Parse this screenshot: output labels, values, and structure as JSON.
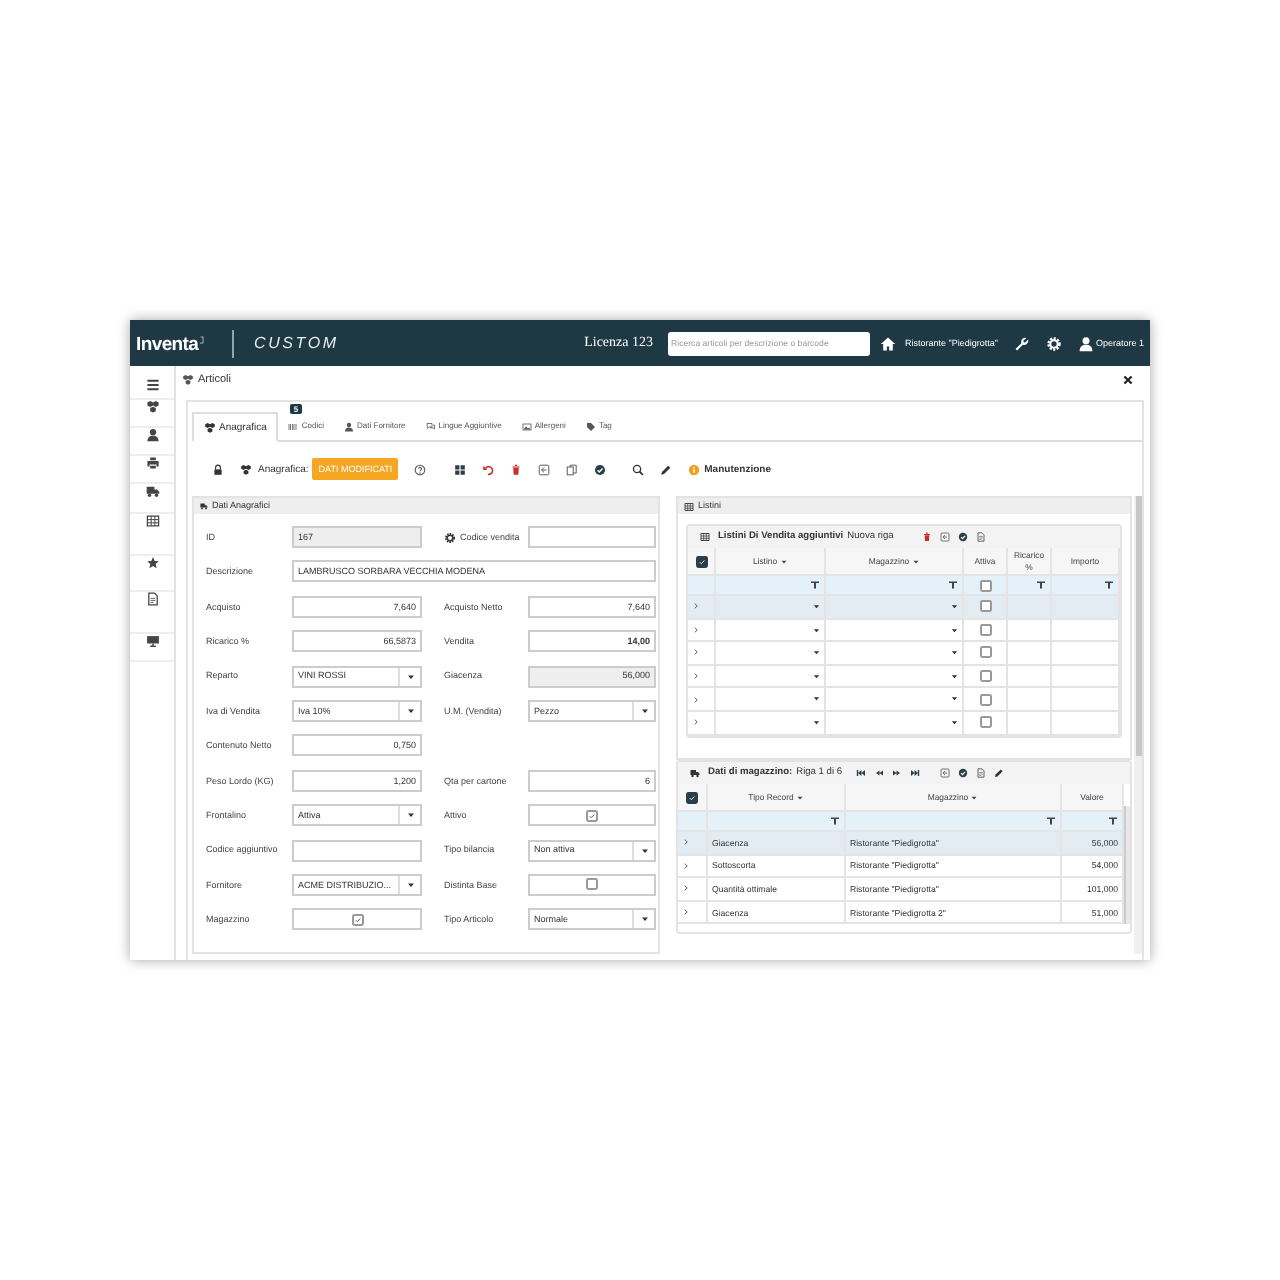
{
  "header": {
    "logo": "Inventa",
    "product": "CUSTOM",
    "license": "Licenza 123",
    "search": {
      "placeholder": "Ricerca articoli per descrizione o barcode"
    },
    "location": "Ristorante \"Piedigrotta\"",
    "user": "Operatore 1"
  },
  "page": {
    "title": "Articoli"
  },
  "tabs": [
    {
      "label": "Anagrafica",
      "selected": true
    },
    {
      "label": "Codici",
      "selected": false,
      "badge": "5"
    },
    {
      "label": "Dati Fornitore",
      "selected": false
    },
    {
      "label": "Lingue Aggiuntive",
      "selected": false
    },
    {
      "label": "Allergeni",
      "selected": false
    },
    {
      "label": "Tag",
      "selected": false
    }
  ],
  "toolbar": {
    "label": "Anagrafica:",
    "status": "DATI MODIFICATI",
    "notice": "Manutenzione"
  },
  "form": {
    "title": "Dati Anagrafici",
    "rows": [
      {
        "fields": [
          {
            "label": "ID",
            "kind": "readonly",
            "value": "167"
          },
          {
            "label": "Codice vendita",
            "kind": "text",
            "settings": true
          }
        ]
      },
      {
        "fields": [
          {
            "label": "Descrizione",
            "kind": "long",
            "value": "LAMBRUSCO SORBARA VECCHIA MODENA"
          }
        ]
      },
      {
        "fields": [
          {
            "label": "Acquisto",
            "kind": "number",
            "value": "7,640"
          },
          {
            "label": "Acquisto Netto",
            "kind": "number",
            "value": "7,640"
          }
        ]
      },
      {
        "fields": [
          {
            "label": "Ricarico %",
            "kind": "number",
            "value": "66,5873"
          },
          {
            "label": "Vendita",
            "kind": "total",
            "value": "14,00"
          }
        ]
      },
      {
        "fields": [
          {
            "label": "Reparto",
            "kind": "select",
            "value": "VINI ROSSI"
          },
          {
            "label": "Giacenza",
            "kind": "readonly-number",
            "value": "56,000"
          }
        ]
      },
      {
        "fields": [
          {
            "label": "Iva di Vendita",
            "kind": "select",
            "value": "Iva 10%"
          },
          {
            "label": "U.M. (Vendita)",
            "kind": "select",
            "value": "Pezzo"
          }
        ]
      },
      {
        "fields": [
          {
            "label": "Contenuto Netto",
            "kind": "number",
            "value": "0,750"
          }
        ]
      },
      {
        "fields": [
          {
            "label": "Peso Lordo (KG)",
            "kind": "number",
            "value": "1,200"
          },
          {
            "label": "Qta per cartone",
            "kind": "number",
            "value": "6"
          }
        ]
      },
      {
        "fields": [
          {
            "label": "Frontalino",
            "kind": "select",
            "value": "Attiva"
          },
          {
            "label": "Attivo",
            "kind": "checkbox",
            "checked": true
          }
        ]
      },
      {
        "fields": [
          {
            "label": "Codice aggiuntivo",
            "kind": "text"
          },
          {
            "label": "Tipo bilancia",
            "kind": "select",
            "value": "Non attiva"
          }
        ]
      },
      {
        "fields": [
          {
            "label": "Fornitore",
            "kind": "select",
            "value": "ACME DISTRIBUZIO..."
          },
          {
            "label": "Distinta Base",
            "kind": "checkbox",
            "checked": false
          }
        ]
      },
      {
        "fields": [
          {
            "label": "Magazzino",
            "kind": "checkbox",
            "checked": true
          },
          {
            "label": "Tipo Articolo",
            "kind": "select",
            "value": "Normale"
          }
        ]
      }
    ]
  },
  "listini": {
    "title": "Listini",
    "subtitle": "Listini Di Vendita aggiuntivi",
    "action": "Nuova riga",
    "select_all": true,
    "filter_checked": false,
    "columns": [
      {
        "label": "Listino",
        "kind": "select",
        "sortable": true
      },
      {
        "label": "Magazzino",
        "kind": "select",
        "sortable": true
      },
      {
        "label": "Attiva",
        "kind": "checkbox",
        "sortable": false
      },
      {
        "label": "Ricarico %",
        "kind": "text",
        "sortable": false
      },
      {
        "label": "Importo",
        "kind": "text",
        "sortable": false
      }
    ],
    "rows": [
      {
        "selected": true,
        "attiva": false
      },
      {
        "selected": false,
        "attiva": false
      },
      {
        "selected": false,
        "attiva": false
      },
      {
        "selected": false,
        "attiva": false
      },
      {
        "selected": false,
        "attiva": false
      },
      {
        "selected": false,
        "attiva": false
      }
    ]
  },
  "stock": {
    "title": "Dati di magazzino:",
    "position": "Riga 1 di 6",
    "select_all": true,
    "columns": [
      {
        "label": "Tipo Record",
        "sortable": true
      },
      {
        "label": "Magazzino",
        "sortable": true
      },
      {
        "label": "Valore",
        "sortable": false
      }
    ],
    "rows": [
      {
        "record": "Giacenza",
        "warehouse": "Ristorante \"Piedigrotta\"",
        "value": "56,000",
        "selected": true
      },
      {
        "record": "Sottoscorta",
        "warehouse": "Ristorante \"Piedigrotta\"",
        "value": "54,000",
        "selected": false
      },
      {
        "record": "Quantità ottimale",
        "warehouse": "Ristorante \"Piedigrotta\"",
        "value": "101,000",
        "selected": false
      },
      {
        "record": "Giacenza",
        "warehouse": "Ristorante \"Piedigrotta 2\"",
        "value": "51,000",
        "selected": false
      }
    ]
  }
}
